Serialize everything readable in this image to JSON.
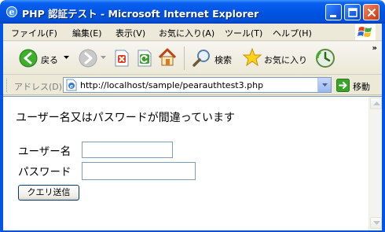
{
  "window": {
    "title": "PHP 認証テスト - Microsoft Internet Explorer"
  },
  "menu": {
    "items": [
      "ファイル(F)",
      "編集(E)",
      "表示(V)",
      "お気に入り(A)",
      "ツール(T)",
      "ヘルプ(H)"
    ]
  },
  "toolbar": {
    "back_label": "戻る",
    "search_label": "検索",
    "favorites_label": "お気に入り",
    "more_label": "»"
  },
  "address": {
    "label": "アドレス(D)",
    "url": "http://localhost/sample/pearauthtest3.php",
    "go_label": "移動"
  },
  "page": {
    "error_message": "ユーザー名又はパスワードが間違っています",
    "username_label": "ユーザー名",
    "username_value": "",
    "password_label": "パスワード",
    "password_value": "",
    "submit_label": "クエリ送信"
  },
  "colors": {
    "titlebar": "#0054e3",
    "chrome": "#ece9d8",
    "input_border": "#7f9db9"
  }
}
